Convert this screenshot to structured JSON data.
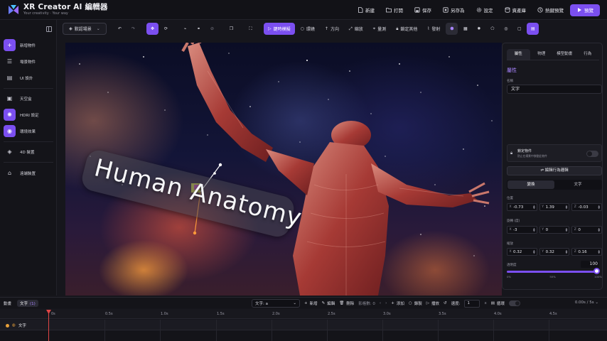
{
  "app": {
    "title": "XR Creator AI 編輯器",
    "subtitle": "Your creativity · Your way"
  },
  "menu": {
    "items": [
      {
        "label": "新建",
        "icon": "new-file-icon"
      },
      {
        "label": "打開",
        "icon": "folder-icon"
      },
      {
        "label": "保存",
        "icon": "save-icon"
      },
      {
        "label": "另存為",
        "icon": "save-as-icon"
      },
      {
        "label": "設定",
        "icon": "gear-icon"
      },
      {
        "label": "資產庫",
        "icon": "database-icon"
      },
      {
        "label": "熱鍵預覽",
        "icon": "hotkey-icon"
      }
    ],
    "preview_label": "預覽"
  },
  "sidebar": {
    "items": [
      {
        "label": "新增物件",
        "icon": "plus-icon"
      },
      {
        "label": "場景物件",
        "icon": "list-icon"
      },
      {
        "label": "UI 設計",
        "icon": "ui-design-icon"
      },
      {
        "label": "天空盒",
        "icon": "skybox-icon"
      },
      {
        "label": "HDRI 設定",
        "icon": "hdri-icon"
      },
      {
        "label": "環境效果",
        "icon": "environment-icon"
      },
      {
        "label": "4D 裝置",
        "icon": "device-4d-icon"
      },
      {
        "label": "遠端裝置",
        "icon": "remote-device-icon"
      }
    ]
  },
  "toolbar": {
    "scene_select": "默認場景",
    "snap_mode_label": "鍵時模擬",
    "orbit_label": "環繞",
    "direction_label": "方向",
    "scale_label": "縮放",
    "measure_label": "量測",
    "lock_others_label": "鎖定其他",
    "publish_label": "發射"
  },
  "viewport": {
    "label_text": "Human Anatomy"
  },
  "panel": {
    "tabs": [
      "屬性",
      "物理",
      "模型動畫",
      "行為"
    ],
    "active_tab": "屬性",
    "section_title": "屬性",
    "name_caption": "名稱",
    "name_value": "文字",
    "lock_title": "鎖定物件",
    "lock_desc": "防止在場景中移動此物件",
    "behavior_button": "編輯行為邏輯",
    "transform_tabs": [
      "變換",
      "文字"
    ],
    "position_label": "位置",
    "position": {
      "x": "-0.73",
      "y": "1.39",
      "z": "-0.03"
    },
    "rotation_label": "旋轉 (度)",
    "rotation": {
      "x": "-3",
      "y": "0",
      "z": "0"
    },
    "scale_label": "縮放",
    "scale": {
      "x": "0.32",
      "y": "0.32",
      "z": "0.16"
    },
    "opacity_label": "透明度",
    "opacity_value": "100",
    "opacity_fraction": 1.0,
    "opacity_ticks": [
      "0%",
      "50%",
      "100%"
    ]
  },
  "timeline": {
    "tab_label": "動畫",
    "chip_label": "文字",
    "chip_count": "(1)",
    "target_select": "文字: a",
    "add_label": "新增",
    "edit_label": "編輯",
    "delete_label": "刪除",
    "frame_label": "影格數: 0",
    "insert_label": "添加",
    "record_label": "錄製",
    "play_label": "播放",
    "speed_label": "速度:",
    "speed_value": "1",
    "speed_unit": "x",
    "loop_label": "循環",
    "time_readout": "0.00s / 5s",
    "ruler": [
      "0s",
      "0.5s",
      "1.0s",
      "1.5s",
      "2.0s",
      "2.5s",
      "3.0s",
      "3.5s",
      "4.0s",
      "4.5s"
    ],
    "track_label": "文字"
  },
  "colors": {
    "accent": "#7b4ff0",
    "background": "#16161c",
    "playhead": "#e04545"
  }
}
